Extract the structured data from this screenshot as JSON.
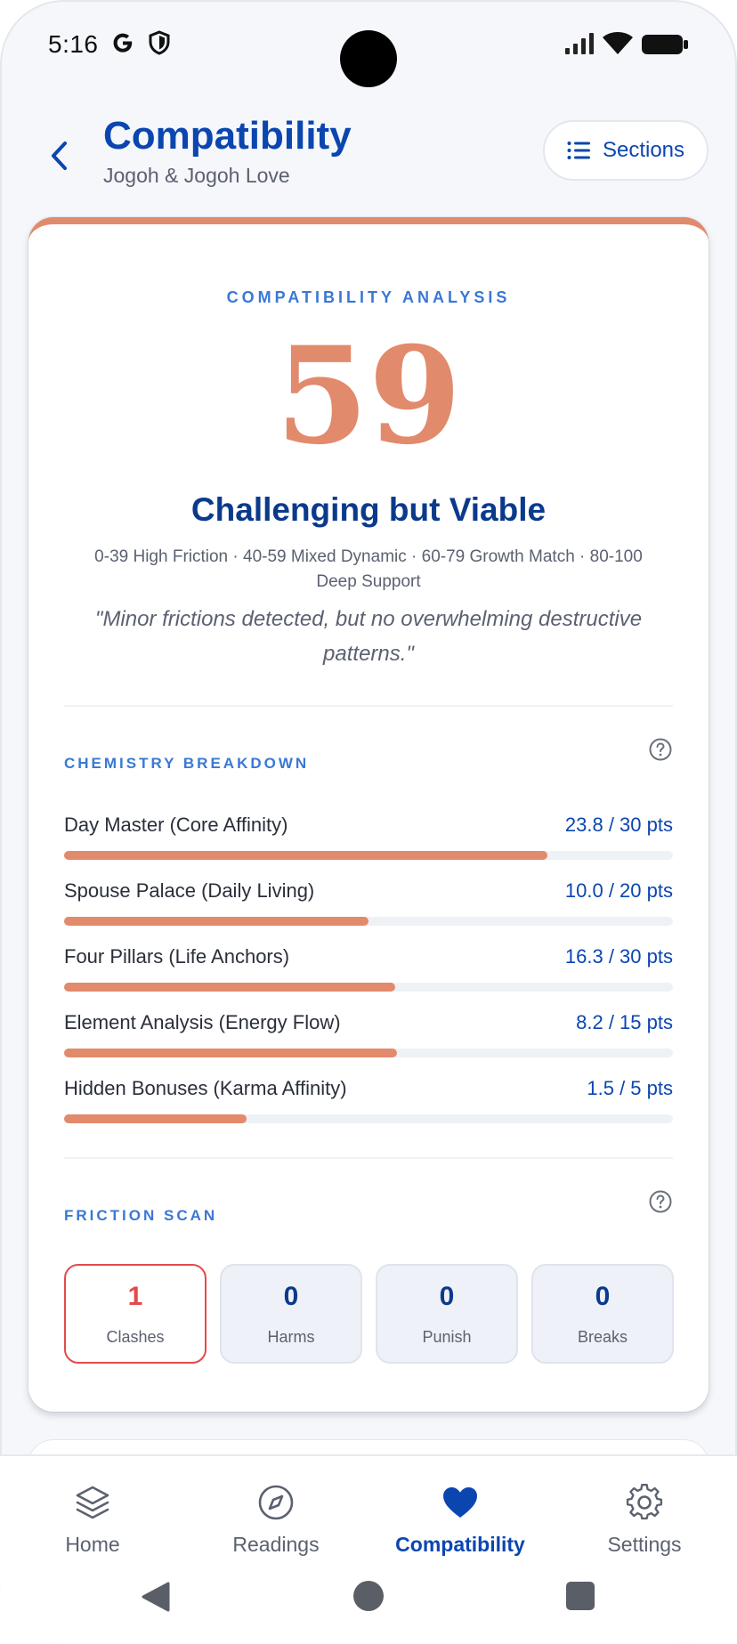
{
  "status_bar": {
    "time": "5:16"
  },
  "header": {
    "title": "Compatibility",
    "subtitle": "Jogoh & Jogoh Love",
    "sections_label": "Sections"
  },
  "analysis": {
    "eyebrow": "COMPATIBILITY ANALYSIS",
    "score": "59",
    "verdict": "Challenging but Viable",
    "scale_legend": "0-39 High Friction · 40-59 Mixed Dynamic · 60-79 Growth Match · 80-100 Deep Support",
    "quote": "\"Minor frictions detected, but no overwhelming destructive patterns.\"",
    "accent_color": "#e28a6c"
  },
  "chemistry": {
    "label": "CHEMISTRY BREAKDOWN",
    "items": [
      {
        "label": "Day Master (Core Affinity)",
        "value": "23.8 / 30 pts",
        "score": 23.8,
        "max": 30
      },
      {
        "label": "Spouse Palace (Daily Living)",
        "value": "10.0 / 20 pts",
        "score": 10.0,
        "max": 20
      },
      {
        "label": "Four Pillars (Life Anchors)",
        "value": "16.3 / 30 pts",
        "score": 16.3,
        "max": 30
      },
      {
        "label": "Element Analysis (Energy Flow)",
        "value": "8.2 / 15 pts",
        "score": 8.2,
        "max": 15
      },
      {
        "label": "Hidden Bonuses (Karma Affinity)",
        "value": "1.5 / 5 pts",
        "score": 1.5,
        "max": 5
      }
    ]
  },
  "friction": {
    "label": "FRICTION SCAN",
    "items": [
      {
        "count": "1",
        "name": "Clashes"
      },
      {
        "count": "0",
        "name": "Harms"
      },
      {
        "count": "0",
        "name": "Punish"
      },
      {
        "count": "0",
        "name": "Breaks"
      }
    ],
    "alert_color": "#e14b4b"
  },
  "bottom_nav": {
    "items": [
      {
        "label": "Home",
        "icon": "layers-icon"
      },
      {
        "label": "Readings",
        "icon": "compass-icon"
      },
      {
        "label": "Compatibility",
        "icon": "heart-icon"
      },
      {
        "label": "Settings",
        "icon": "gear-icon"
      }
    ],
    "active": "Compatibility"
  }
}
